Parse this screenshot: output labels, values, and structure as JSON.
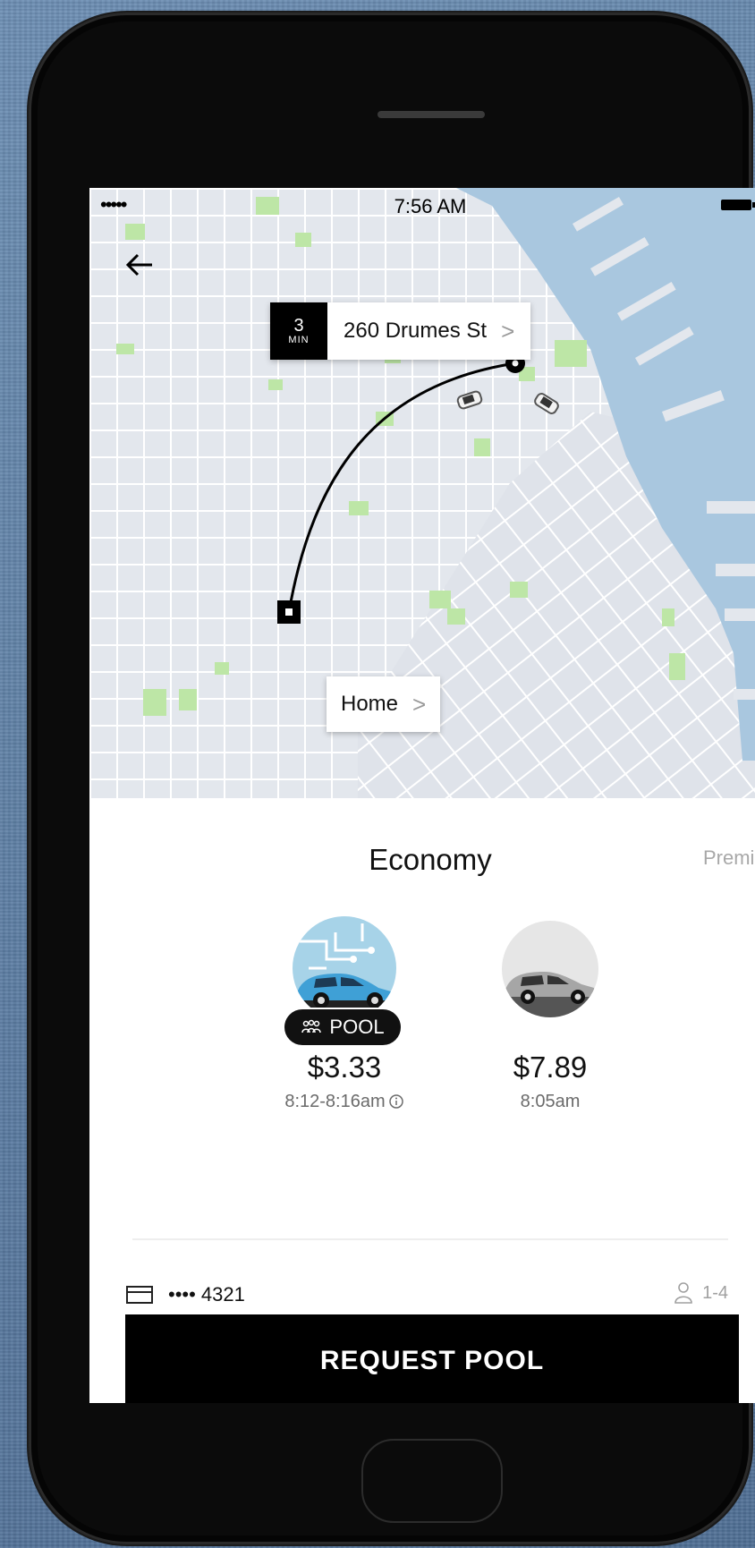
{
  "status_bar": {
    "signal": "•••••",
    "time": "7:56 AM"
  },
  "map": {
    "pickup": {
      "eta_value": "3",
      "eta_unit": "MIN",
      "address": "260 Drumes St",
      "chevron": ">"
    },
    "dropoff": {
      "label": "Home",
      "chevron": ">"
    }
  },
  "panel": {
    "category": "Economy",
    "next_category": "Premi",
    "vehicles": [
      {
        "badge": "POOL",
        "badge_icon": "group-icon",
        "price": "$3.33",
        "eta": "8:12-8:16am",
        "info_icon": "info-icon",
        "selected": true
      },
      {
        "price": "$7.89",
        "eta": "8:05am",
        "selected": false
      }
    ],
    "payment": {
      "card_icon": "credit-card-icon",
      "card": "•••• 4321"
    },
    "capacity": {
      "icon": "person-icon",
      "range": "1-4"
    },
    "request_button": "REQUEST POOL"
  },
  "colors": {
    "accent": "#000000",
    "water": "#a9c7df",
    "park": "#bde6a6",
    "map_bg": "#e4e8ee"
  }
}
